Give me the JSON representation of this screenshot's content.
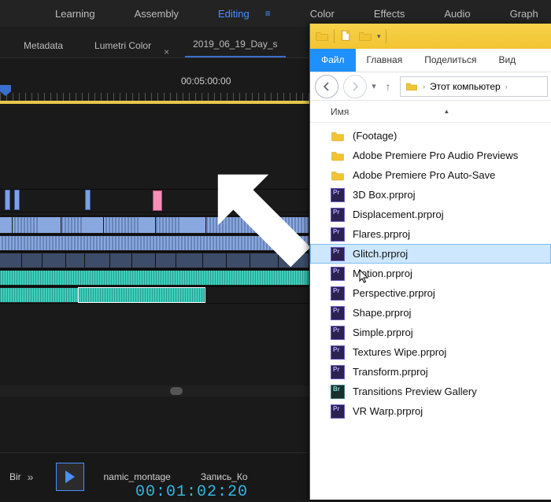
{
  "workspace": {
    "tabs": [
      "Learning",
      "Assembly",
      "Editing",
      "Color",
      "Effects",
      "Audio",
      "Graph"
    ],
    "active": "Editing"
  },
  "panel_tabs": {
    "metadata": "Metadata",
    "lumetri": "Lumetri Color",
    "sequence": "2019_06_19_Day_s"
  },
  "time_ruler": {
    "label": "00:05:00:00"
  },
  "bottom": {
    "bin_label": "Bir",
    "proj1": "namic_montage",
    "proj2": "Запись_Ко",
    "timecode": "00:01:02:20",
    "expand_glyph": "»"
  },
  "explorer": {
    "ribbon": {
      "file": "Файл",
      "home": "Главная",
      "share": "Поделиться",
      "view": "Вид"
    },
    "breadcrumb": {
      "root_glyph": "▶",
      "loc": "Этот компьютер",
      "sep": "›"
    },
    "column_header": "Имя",
    "items": [
      {
        "kind": "folder",
        "name": "(Footage)"
      },
      {
        "kind": "folder",
        "name": "Adobe Premiere Pro Audio Previews"
      },
      {
        "kind": "folder",
        "name": "Adobe Premiere Pro Auto-Save"
      },
      {
        "kind": "prproj",
        "name": "3D Box.prproj"
      },
      {
        "kind": "prproj",
        "name": "Displacement.prproj"
      },
      {
        "kind": "prproj",
        "name": "Flares.prproj"
      },
      {
        "kind": "prproj",
        "name": "Glitch.prproj",
        "selected": true
      },
      {
        "kind": "prproj",
        "name": "Motion.prproj"
      },
      {
        "kind": "prproj",
        "name": "Perspective.prproj"
      },
      {
        "kind": "prproj",
        "name": "Shape.prproj"
      },
      {
        "kind": "prproj",
        "name": "Simple.prproj"
      },
      {
        "kind": "prproj",
        "name": "Textures Wipe.prproj"
      },
      {
        "kind": "prproj",
        "name": "Transform.prproj"
      },
      {
        "kind": "bridge",
        "name": "Transitions Preview Gallery"
      },
      {
        "kind": "prproj",
        "name": "VR Warp.prproj"
      }
    ]
  }
}
